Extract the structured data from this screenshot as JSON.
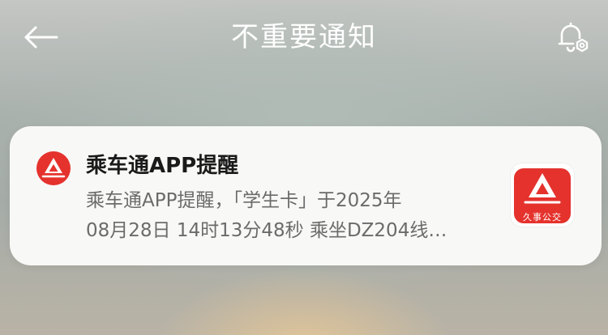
{
  "header": {
    "title": "不重要通知",
    "back_icon": "back-arrow-icon",
    "settings_icon": "notification-settings-icon"
  },
  "notification": {
    "app_icon": "app-logo-icon",
    "title": "乘车通APP提醒",
    "body_line1": "乘车通APP提醒，「学生卡」于2025年",
    "body_line2": "08月28日 14时13分48秒 乘坐DZ204线…",
    "thumbnail_label": "久事公交"
  },
  "colors": {
    "brand_red": "#e5322d",
    "card_bg": "#f8f8f7",
    "title_text": "#1a1a1a",
    "body_text": "#6b6b6b",
    "header_text": "#ffffff"
  }
}
